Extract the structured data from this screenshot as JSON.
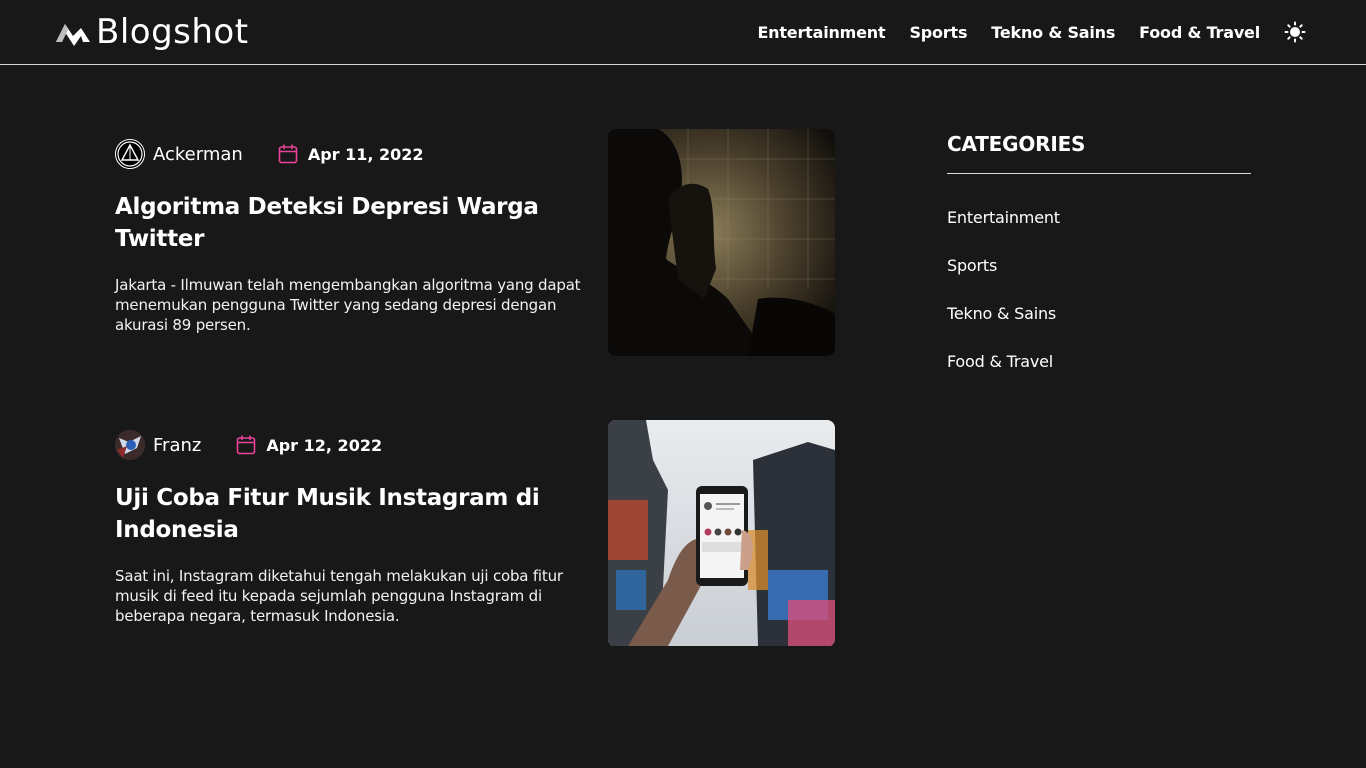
{
  "brand": {
    "name": "Blogshot"
  },
  "nav": {
    "items": [
      {
        "label": "Entertainment"
      },
      {
        "label": "Sports"
      },
      {
        "label": "Tekno & Sains"
      },
      {
        "label": "Food & Travel"
      }
    ],
    "theme_icon": "sun-icon"
  },
  "articles": [
    {
      "author": "Ackerman",
      "date": "Apr 11, 2022",
      "title": "Algoritma Deteksi Depresi Warga Twitter",
      "excerpt": "Jakarta - Ilmuwan telah mengembangkan algoritma yang dapat menemukan pengguna Twitter yang sedang depresi dengan akurasi 89 persen."
    },
    {
      "author": "Franz",
      "date": "Apr 12, 2022",
      "title": "Uji Coba Fitur Musik Instagram di Indonesia",
      "excerpt": "Saat ini, Instagram diketahui tengah melakukan uji coba fitur musik di feed itu kepada sejumlah pengguna Instagram di beberapa negara, termasuk Indonesia."
    }
  ],
  "sidebar": {
    "title": "CATEGORIES",
    "items": [
      {
        "label": "Entertainment"
      },
      {
        "label": "Sports"
      },
      {
        "label": "Tekno & Sains"
      },
      {
        "label": "Food & Travel"
      }
    ]
  },
  "colors": {
    "background": "#181818",
    "accent": "#e8449a",
    "text": "#ffffff"
  }
}
